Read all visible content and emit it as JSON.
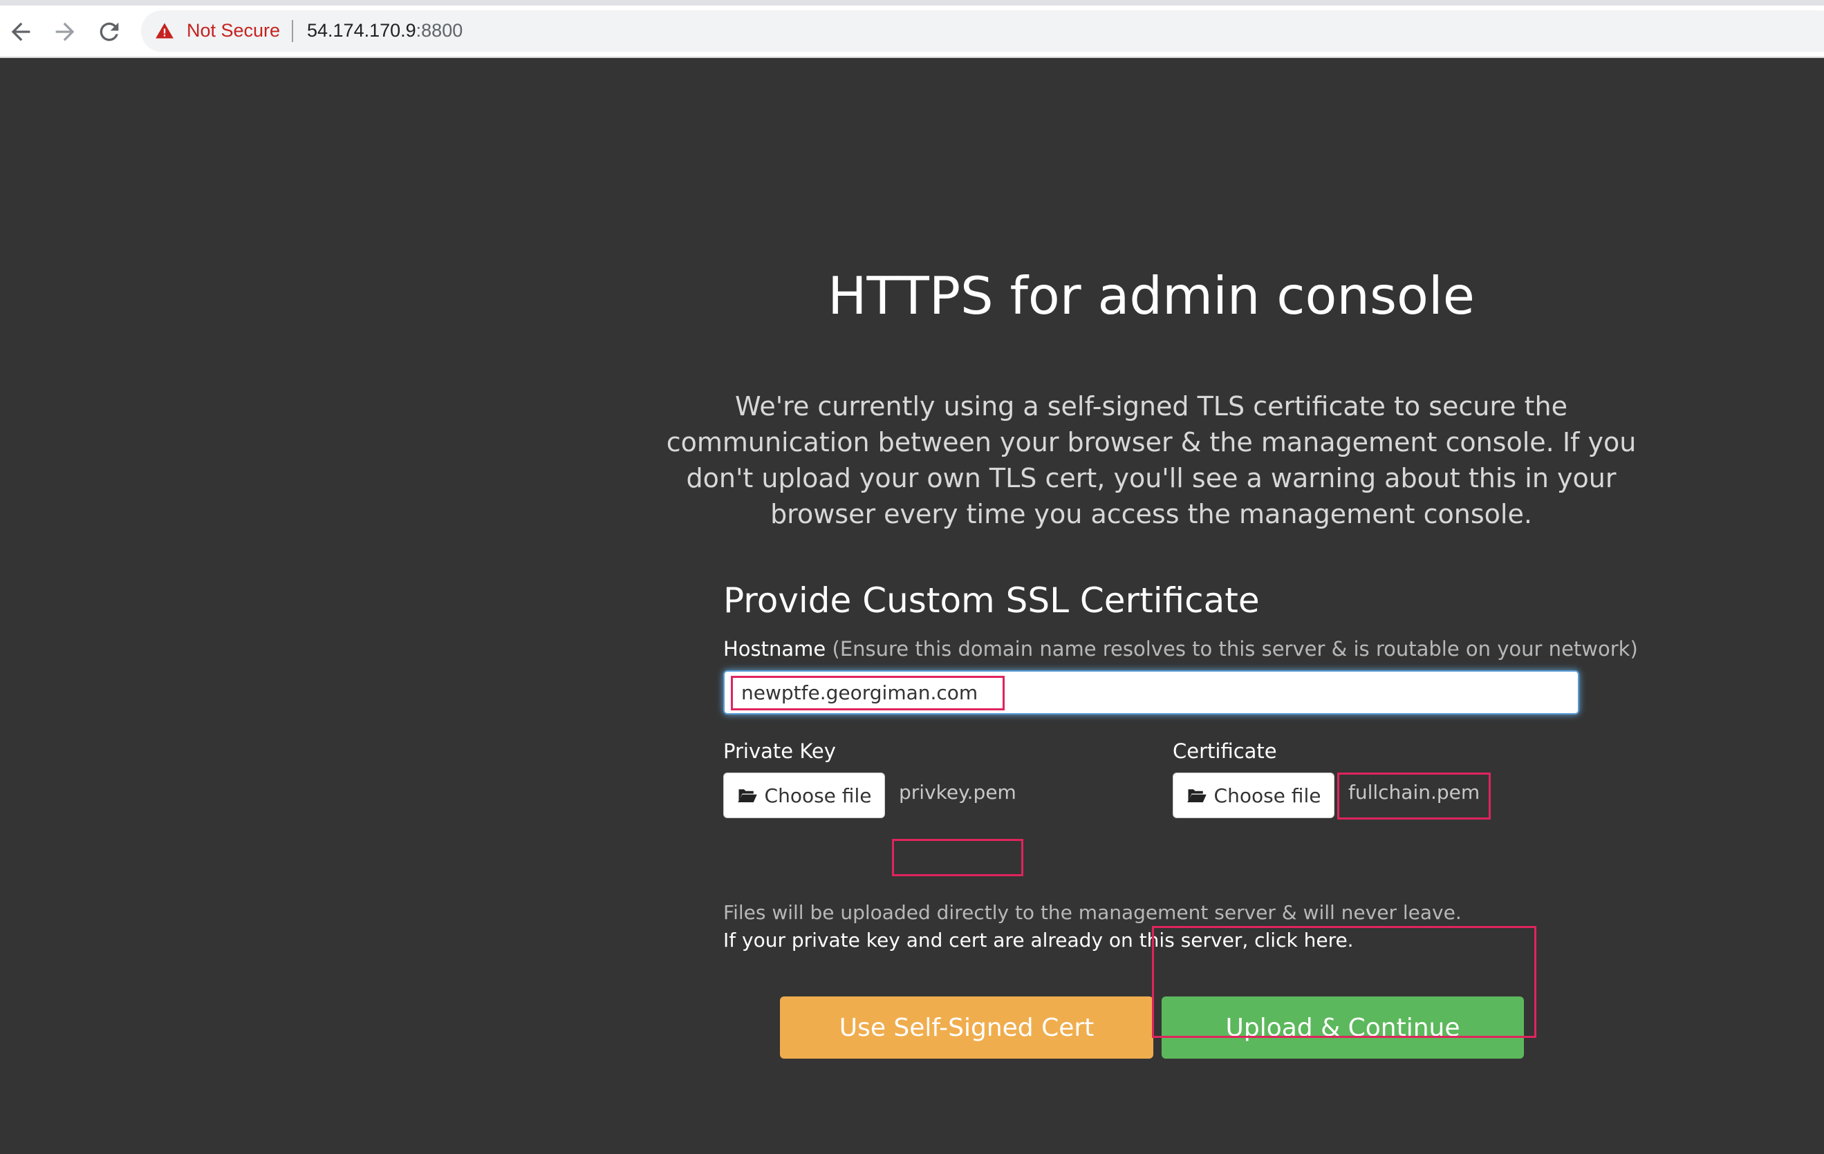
{
  "browser": {
    "security_label": "Not Secure",
    "url_host": "54.174.170.9",
    "url_port": ":8800",
    "icons": [
      "back-arrow-icon",
      "forward-arrow-icon",
      "reload-icon",
      "warning-icon"
    ]
  },
  "page": {
    "title": "HTTPS for admin console",
    "intro": "We're currently using a self-signed TLS certificate to secure the communication between your browser & the management console. If you don't upload your own TLS cert, you'll see a warning about this in your browser every time you access the management console.",
    "section_title": "Provide Custom SSL Certificate",
    "hostname": {
      "label": "Hostname",
      "hint": "(Ensure this domain name resolves to this server & is routable on your network)",
      "value": "newptfe.georgiman.com"
    },
    "private_key": {
      "label": "Private Key",
      "button": "Choose file",
      "file_name": "privkey.pem"
    },
    "certificate": {
      "label": "Certificate",
      "button": "Choose file",
      "file_name": "fullchain.pem"
    },
    "help_text_1": "Files will be uploaded directly to the management server & will never leave.",
    "help_text_2": "If your private key and cert are already on this server, click here.",
    "buttons": {
      "self_signed": "Use Self-Signed Cert",
      "upload": "Upload & Continue"
    }
  },
  "colors": {
    "background": "#343434",
    "self_signed_button": "#f0ad4e",
    "upload_button": "#5cb85c",
    "not_secure": "#c5221f",
    "highlight_box": "#e0245e"
  }
}
